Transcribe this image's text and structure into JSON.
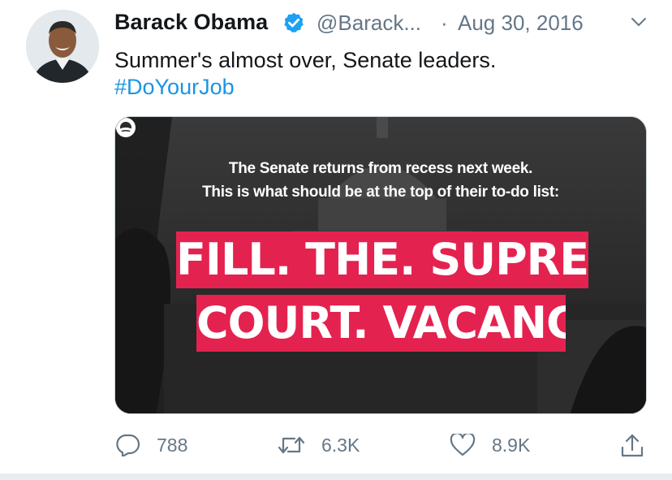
{
  "tweet": {
    "author": {
      "name": "Barack Obama",
      "handle": "@Barack...",
      "verified": true,
      "avatar_icon": "avatar-photo"
    },
    "separator": "·",
    "date": "Aug 30, 2016",
    "text": "Summer's almost over, Senate leaders.",
    "hashtag": "#DoYourJob",
    "media": {
      "subtitle_line1": "The Senate returns from recess next week.",
      "subtitle_line2": "This is what should be at the top of their to-do list:",
      "headline_line1": "FILL. THE. SUPREME.",
      "headline_line2": "COURT. VACANCY.",
      "band_color": "#e4224f"
    },
    "actions": {
      "replies": "788",
      "retweets": "6.3K",
      "likes": "8.9K"
    }
  },
  "colors": {
    "link": "#1b95e0",
    "secondary_text": "#657786",
    "verified": "#1da1f2"
  }
}
